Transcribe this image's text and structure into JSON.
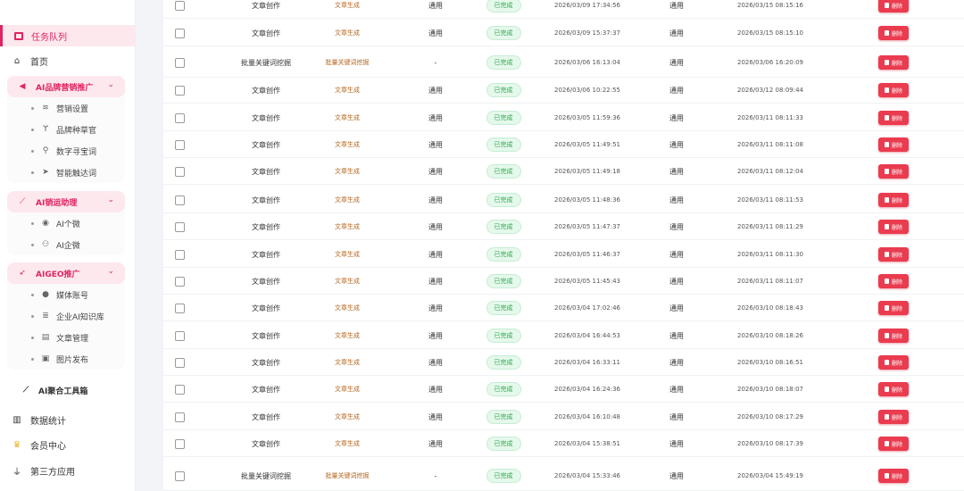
{
  "sidebar": {
    "task_queue": "任务队列",
    "home": "首页",
    "groups": [
      {
        "label": "AI品牌营销推广",
        "icon": "megaphone-icon",
        "items": [
          {
            "label": "营销设置",
            "icon": "stack-icon"
          },
          {
            "label": "品牌种草官",
            "icon": "sprout-icon"
          },
          {
            "label": "数字寻宝词",
            "icon": "search-icon"
          },
          {
            "label": "智能触达词",
            "icon": "send-icon"
          }
        ]
      },
      {
        "label": "AI销运助理",
        "icon": "chart-line-icon",
        "items": [
          {
            "label": "AI个微",
            "icon": "user-circle-icon"
          },
          {
            "label": "AI企微",
            "icon": "users-icon"
          }
        ]
      },
      {
        "label": "AIGEO推广",
        "icon": "rocket-icon",
        "items": [
          {
            "label": "媒体账号",
            "icon": "user-icon"
          },
          {
            "label": "企业AI知识库",
            "icon": "database-icon"
          },
          {
            "label": "文章管理",
            "icon": "document-icon"
          },
          {
            "label": "图片发布",
            "icon": "image-icon"
          }
        ]
      }
    ],
    "toolbox": "AI聚合工具箱",
    "stats": "数据统计",
    "member": "会员中心",
    "third_party": "第三方应用"
  },
  "table": {
    "delete_label": "删除",
    "rows": [
      {
        "name": "文章创作",
        "type": "文章生成",
        "mode": "通用",
        "status": "已完成",
        "time1": "2026/03/09 17:34:56",
        "mode2": "通用",
        "time2": "2026/03/15 08:15:16"
      },
      {
        "name": "文章创作",
        "type": "文章生成",
        "mode": "通用",
        "status": "已完成",
        "time1": "2026/03/09 15:37:37",
        "mode2": "通用",
        "time2": "2026/03/15 08:15:10"
      },
      {
        "name": "批量关键词挖掘",
        "type": "批量关键词挖掘",
        "mode": "-",
        "status": "已完成",
        "time1": "2026/03/06 16:13:04",
        "mode2": "通用",
        "time2": "2026/03/06 16:20:09"
      },
      {
        "name": "文章创作",
        "type": "文章生成",
        "mode": "通用",
        "status": "已完成",
        "time1": "2026/03/06 10:22:55",
        "mode2": "通用",
        "time2": "2026/03/12 08:09:44"
      },
      {
        "name": "文章创作",
        "type": "文章生成",
        "mode": "通用",
        "status": "已完成",
        "time1": "2026/03/05 11:59:36",
        "mode2": "通用",
        "time2": "2026/03/11 08:11:33"
      },
      {
        "name": "文章创作",
        "type": "文章生成",
        "mode": "通用",
        "status": "已完成",
        "time1": "2026/03/05 11:49:51",
        "mode2": "通用",
        "time2": "2026/03/11 08:11:08"
      },
      {
        "name": "文章创作",
        "type": "文章生成",
        "mode": "通用",
        "status": "已完成",
        "time1": "2026/03/05 11:49:18",
        "mode2": "通用",
        "time2": "2026/03/11 08:12:04"
      },
      {
        "name": "文章创作",
        "type": "文章生成",
        "mode": "通用",
        "status": "已完成",
        "time1": "2026/03/05 11:48:36",
        "mode2": "通用",
        "time2": "2026/03/11 08:11:53"
      },
      {
        "name": "文章创作",
        "type": "文章生成",
        "mode": "通用",
        "status": "已完成",
        "time1": "2026/03/05 11:47:37",
        "mode2": "通用",
        "time2": "2026/03/11 08:11:29"
      },
      {
        "name": "文章创作",
        "type": "文章生成",
        "mode": "通用",
        "status": "已完成",
        "time1": "2026/03/05 11:46:37",
        "mode2": "通用",
        "time2": "2026/03/11 08:11:30"
      },
      {
        "name": "文章创作",
        "type": "文章生成",
        "mode": "通用",
        "status": "已完成",
        "time1": "2026/03/05 11:45:43",
        "mode2": "通用",
        "time2": "2026/03/11 08:11:07"
      },
      {
        "name": "文章创作",
        "type": "文章生成",
        "mode": "通用",
        "status": "已完成",
        "time1": "2026/03/04 17:02:46",
        "mode2": "通用",
        "time2": "2026/03/10 08:18:43"
      },
      {
        "name": "文章创作",
        "type": "文章生成",
        "mode": "通用",
        "status": "已完成",
        "time1": "2026/03/04 16:44:53",
        "mode2": "通用",
        "time2": "2026/03/10 08:18:26"
      },
      {
        "name": "文章创作",
        "type": "文章生成",
        "mode": "通用",
        "status": "已完成",
        "time1": "2026/03/04 16:33:11",
        "mode2": "通用",
        "time2": "2026/03/10 08:16:51"
      },
      {
        "name": "文章创作",
        "type": "文章生成",
        "mode": "通用",
        "status": "已完成",
        "time1": "2026/03/04 16:24:36",
        "mode2": "通用",
        "time2": "2026/03/10 08:18:07"
      },
      {
        "name": "文章创作",
        "type": "文章生成",
        "mode": "通用",
        "status": "已完成",
        "time1": "2026/03/04 16:10:48",
        "mode2": "通用",
        "time2": "2026/03/10 08:17:29"
      },
      {
        "name": "文章创作",
        "type": "文章生成",
        "mode": "通用",
        "status": "已完成",
        "time1": "2026/03/04 15:38:51",
        "mode2": "通用",
        "time2": "2026/03/10 08:17:39"
      },
      {
        "name": "批量关键词挖掘",
        "type": "批量关键词挖掘",
        "mode": "-",
        "status": "已完成",
        "time1": "2026/03/04 15:33:46",
        "mode2": "通用",
        "time2": "2026/03/04 15:49:19"
      }
    ]
  },
  "colors": {
    "accent": "#e0245e",
    "status_green": "#2ba84a",
    "delete_red": "#ea3b4f"
  }
}
